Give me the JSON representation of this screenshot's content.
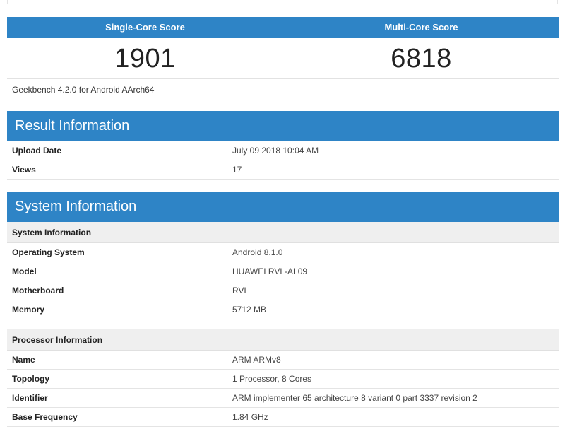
{
  "scores": {
    "single_label": "Single-Core Score",
    "multi_label": "Multi-Core Score",
    "single_value": "1901",
    "multi_value": "6818",
    "caption": "Geekbench 4.2.0 for Android AArch64"
  },
  "result": {
    "title": "Result Information",
    "rows": [
      {
        "key": "Upload Date",
        "value": "July 09 2018 10:04 AM"
      },
      {
        "key": "Views",
        "value": "17"
      }
    ]
  },
  "system": {
    "title": "System Information",
    "sys_sub": "System Information",
    "sys_rows": [
      {
        "key": "Operating System",
        "value": "Android 8.1.0"
      },
      {
        "key": "Model",
        "value": "HUAWEI RVL-AL09"
      },
      {
        "key": "Motherboard",
        "value": "RVL"
      },
      {
        "key": "Memory",
        "value": "5712 MB"
      }
    ],
    "proc_sub": "Processor Information",
    "proc_rows": [
      {
        "key": "Name",
        "value": "ARM ARMv8"
      },
      {
        "key": "Topology",
        "value": "1 Processor, 8 Cores"
      },
      {
        "key": "Identifier",
        "value": "ARM implementer 65 architecture 8 variant 0 part 3337 revision 2"
      },
      {
        "key": "Base Frequency",
        "value": "1.84 GHz"
      }
    ]
  }
}
